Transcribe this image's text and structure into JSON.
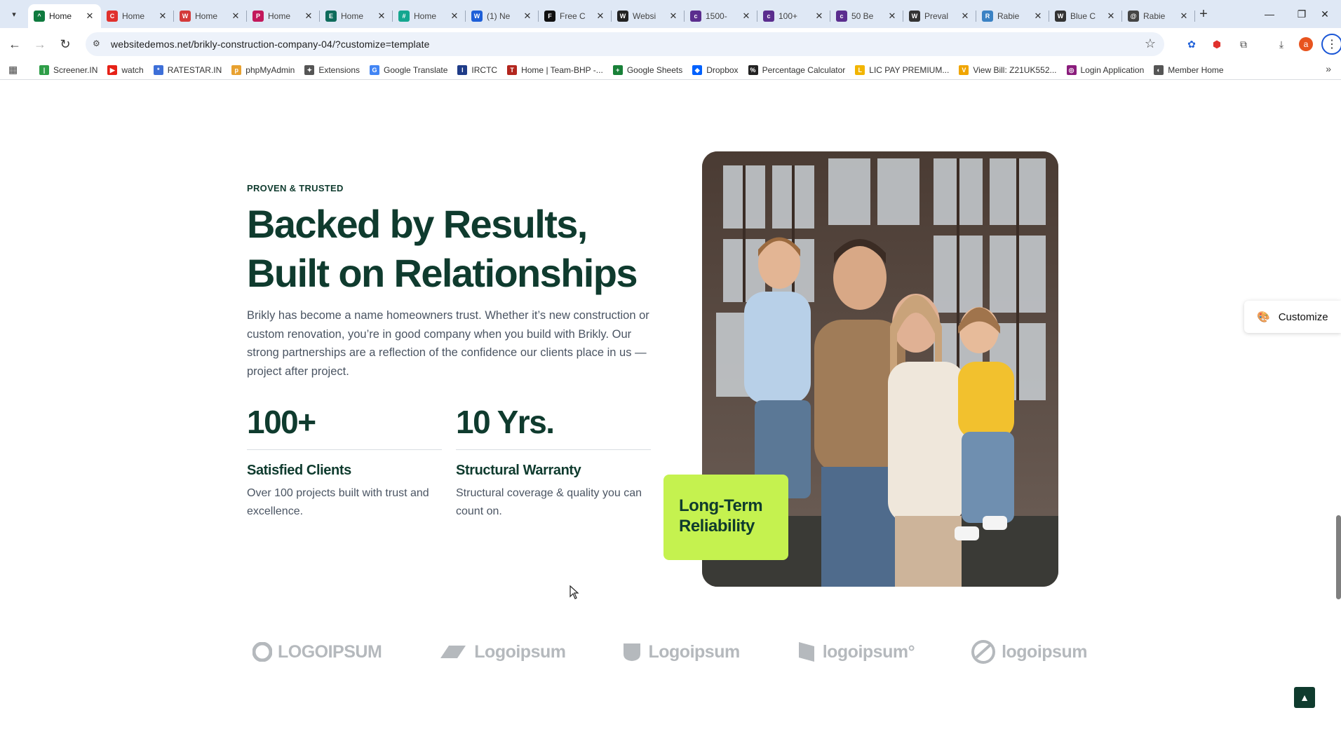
{
  "browser": {
    "tabs": [
      {
        "title": "Home",
        "active": true,
        "color": "#0f7a3e",
        "glyph": "^"
      },
      {
        "title": "Home",
        "active": false,
        "color": "#e0312d",
        "glyph": "C"
      },
      {
        "title": "Home",
        "active": false,
        "color": "#d43a3a",
        "glyph": "W"
      },
      {
        "title": "Home",
        "active": false,
        "color": "#c2185b",
        "glyph": "P"
      },
      {
        "title": "Home",
        "active": false,
        "color": "#0e6b5b",
        "glyph": "E"
      },
      {
        "title": "Home",
        "active": false,
        "color": "#14a68f",
        "glyph": "#"
      },
      {
        "title": "(1) Ne",
        "active": false,
        "color": "#1e5fd8",
        "glyph": "W"
      },
      {
        "title": "Free C",
        "active": false,
        "color": "#111111",
        "glyph": "F"
      },
      {
        "title": "Websi",
        "active": false,
        "color": "#222222",
        "glyph": "W"
      },
      {
        "title": "1500-",
        "active": false,
        "color": "#5b2d8e",
        "glyph": "c"
      },
      {
        "title": "100+",
        "active": false,
        "color": "#5b2d8e",
        "glyph": "c"
      },
      {
        "title": "50 Be",
        "active": false,
        "color": "#5b2d8e",
        "glyph": "c"
      },
      {
        "title": "Preval",
        "active": false,
        "color": "#333333",
        "glyph": "W"
      },
      {
        "title": "Rabie",
        "active": false,
        "color": "#3b82c4",
        "glyph": "R"
      },
      {
        "title": "Blue C",
        "active": false,
        "color": "#333333",
        "glyph": "W"
      },
      {
        "title": "Rabie",
        "active": false,
        "color": "#444444",
        "glyph": "@"
      }
    ],
    "url": "websitedemos.net/brikly-construction-company-04/?customize=template",
    "bookmarks": [
      {
        "label": "Screener.IN",
        "color": "#2e9e48",
        "glyph": "|"
      },
      {
        "label": "watch",
        "color": "#e62117",
        "glyph": "▶"
      },
      {
        "label": "RATESTAR.IN",
        "color": "#3d6fd8",
        "glyph": "*"
      },
      {
        "label": "phpMyAdmin",
        "color": "#e8a130",
        "glyph": "p"
      },
      {
        "label": "Extensions",
        "color": "#555555",
        "glyph": "✦"
      },
      {
        "label": "Google Translate",
        "color": "#4285f4",
        "glyph": "G"
      },
      {
        "label": "IRCTC",
        "color": "#1f3c88",
        "glyph": "I"
      },
      {
        "label": "Home | Team-BHP -...",
        "color": "#b3261e",
        "glyph": "T"
      },
      {
        "label": "Google Sheets",
        "color": "#188038",
        "glyph": "+"
      },
      {
        "label": "Dropbox",
        "color": "#0061fe",
        "glyph": "◆"
      },
      {
        "label": "Percentage Calculator",
        "color": "#222222",
        "glyph": "%"
      },
      {
        "label": "LIC PAY PREMIUM...",
        "color": "#f2b500",
        "glyph": "L"
      },
      {
        "label": "View Bill: Z21UK552...",
        "color": "#f0a500",
        "glyph": "V"
      },
      {
        "label": "Login Application",
        "color": "#8a1c7c",
        "glyph": "◎"
      },
      {
        "label": "Member Home",
        "color": "#555555",
        "glyph": "◐"
      }
    ]
  },
  "section": {
    "eyebrow": "PROVEN & TRUSTED",
    "headline_line1": "Backed by Results,",
    "headline_line2": "Built on Relationships",
    "lead": "Brikly has become a name homeowners trust. Whether it’s new construction or custom renovation, you’re in good company when you build with Brikly. Our strong partnerships are a reflection of the confidence our clients place in us — project after project.",
    "stats": [
      {
        "number": "100+",
        "label": "Satisfied Clients",
        "desc": "Over 100 projects built with trust and excellence."
      },
      {
        "number": "10 Yrs.",
        "label": "Structural Warranty",
        "desc": "Structural coverage & quality you can count on."
      }
    ],
    "badge_line1": "Long-Term",
    "badge_line2": "Reliability",
    "accent_color": "#c5f24f",
    "brand_color": "#0f3b2e"
  },
  "customize": {
    "label": "Customize"
  },
  "logos": [
    "LOGOIPSUM",
    "Logoipsum",
    "Logoipsum",
    "logoipsum°",
    "logoipsum"
  ]
}
